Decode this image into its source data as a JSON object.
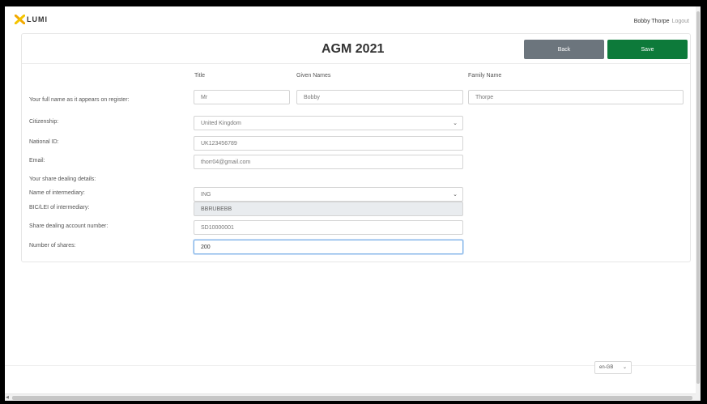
{
  "header": {
    "logo_text": "LUMI",
    "user_name": "Bobby Thorpe",
    "logout_label": "Logout"
  },
  "page": {
    "title": "AGM 2021",
    "back_label": "Back",
    "save_label": "Save"
  },
  "form": {
    "full_name_label": "Your full name as it appears on register:",
    "title_label": "Title",
    "given_names_label": "Given Names",
    "family_name_label": "Family Name",
    "title_value": "Mr",
    "given_names_value": "Bobby",
    "family_name_value": "Thorpe",
    "citizenship_label": "Citizenship:",
    "citizenship_value": "United Kingdom",
    "national_id_label": "National ID:",
    "national_id_value": "UK123456789",
    "email_label": "Email:",
    "email_value": "thorr04@gmail.com",
    "share_dealing_header": "Your share dealing details:",
    "intermediary_label": "Name of intermediary:",
    "intermediary_value": "ING",
    "bic_label": "BIC/LEI of intermediary:",
    "bic_value": "BBRUBEBB",
    "account_label": "Share dealing account number:",
    "account_value": "SD10000001",
    "shares_label": "Number of shares:",
    "shares_value": "200"
  },
  "footer": {
    "language": "en-GB"
  },
  "colors": {
    "save": "#0d7a3a",
    "back": "#6c757d",
    "logo_accent": "#f2a900"
  }
}
